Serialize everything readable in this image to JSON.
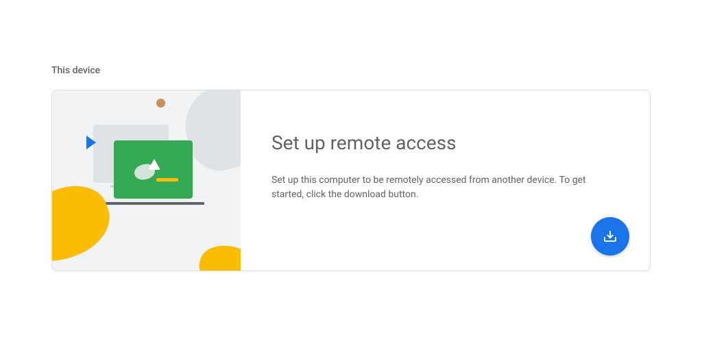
{
  "section": {
    "title": "This device"
  },
  "card": {
    "heading": "Set up remote access",
    "description": "Set up this computer to be remotely accessed from another device. To get started, click the download button."
  },
  "colors": {
    "accent": "#1a73e8",
    "green": "#34a853",
    "yellow": "#fbbc04",
    "text_secondary": "#5f6368",
    "border": "#dadce0",
    "illustration_bg": "#f1f3f4"
  }
}
